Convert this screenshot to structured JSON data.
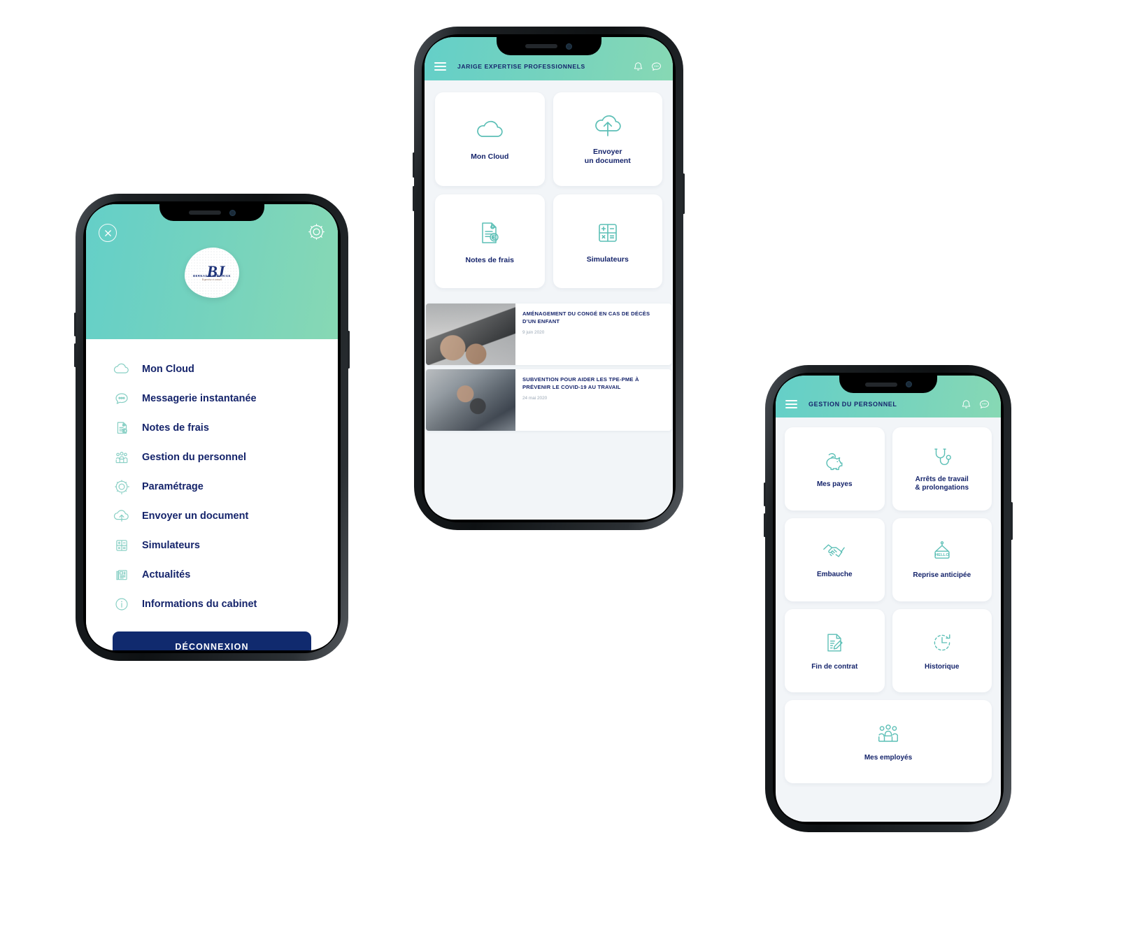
{
  "theme": {
    "teal_start": "#64cfc8",
    "teal_end": "#87d8b4",
    "navy": "#15246b",
    "logout_bg": "#102a6e",
    "screen_bg": "#f2f5f8",
    "icon_teal": "#6ec9bd"
  },
  "phone_menu": {
    "name": "side-menu-screen",
    "close_label": "×",
    "settings_icon": "gear-icon",
    "logo": {
      "brand": "BERNADETTE JARIGE",
      "monogram": "BJ",
      "tagline": "Expertise et conseil"
    },
    "items": [
      {
        "label": "Mon Cloud",
        "icon": "cloud-icon"
      },
      {
        "label": "Messagerie instantanée",
        "icon": "chat-bubble-icon"
      },
      {
        "label": "Notes de frais",
        "icon": "expense-report-icon"
      },
      {
        "label": "Gestion du personnel",
        "icon": "people-group-icon"
      },
      {
        "label": "Paramétrage",
        "icon": "gear-icon"
      },
      {
        "label": "Envoyer un document",
        "icon": "cloud-upload-icon"
      },
      {
        "label": "Simulateurs",
        "icon": "calculator-icon"
      },
      {
        "label": "Actualités",
        "icon": "newspaper-icon"
      },
      {
        "label": "Informations du cabinet",
        "icon": "info-icon"
      }
    ],
    "logout_label": "DÉCONNEXION"
  },
  "phone_home": {
    "name": "home-screen",
    "header": {
      "title": "JARIGE EXPERTISE PROFESSIONNELS",
      "menu_icon": "hamburger-icon",
      "bell_icon": "bell-icon",
      "chat_icon": "chat-bubble-icon"
    },
    "tiles": [
      {
        "label": "Mon Cloud",
        "icon": "cloud-icon"
      },
      {
        "label": "Envoyer\nun document",
        "icon": "cloud-upload-icon"
      },
      {
        "label": "Notes de frais",
        "icon": "expense-report-icon"
      },
      {
        "label": "Simulateurs",
        "icon": "calculator-icon"
      }
    ],
    "news": [
      {
        "title": "AMÉNAGEMENT DU CONGÉ EN CAS DE DÉCÈS D’UN ENFANT",
        "date": "9 juin 2020",
        "thumb": "laptop-hands-photo"
      },
      {
        "title": "SUBVENTION POUR AIDER LES TPE-PME À PRÉVENIR LE COVID-19 AU TRAVAIL",
        "date": "24 mai 2020",
        "thumb": "person-calculator-photo"
      }
    ]
  },
  "phone_hr": {
    "name": "personnel-management-screen",
    "header": {
      "title": "GESTION DU PERSONNEL",
      "menu_icon": "hamburger-icon",
      "bell_icon": "bell-icon",
      "chat_icon": "chat-bubble-icon"
    },
    "tiles": [
      {
        "label": "Mes payes",
        "icon": "piggy-bank-icon",
        "wide": false
      },
      {
        "label": "Arrêts de travail\n& prolongations",
        "icon": "stethoscope-icon",
        "wide": false
      },
      {
        "label": "Embauche",
        "icon": "handshake-icon",
        "wide": false
      },
      {
        "label": "Reprise anticipée",
        "icon": "hello-sign-icon",
        "wide": false
      },
      {
        "label": "Fin de contrat",
        "icon": "document-pencil-icon",
        "wide": false
      },
      {
        "label": "Historique",
        "icon": "clock-history-icon",
        "wide": false
      },
      {
        "label": "Mes employés",
        "icon": "people-group-icon",
        "wide": true
      }
    ],
    "hello_sign_text": "HELLO"
  }
}
